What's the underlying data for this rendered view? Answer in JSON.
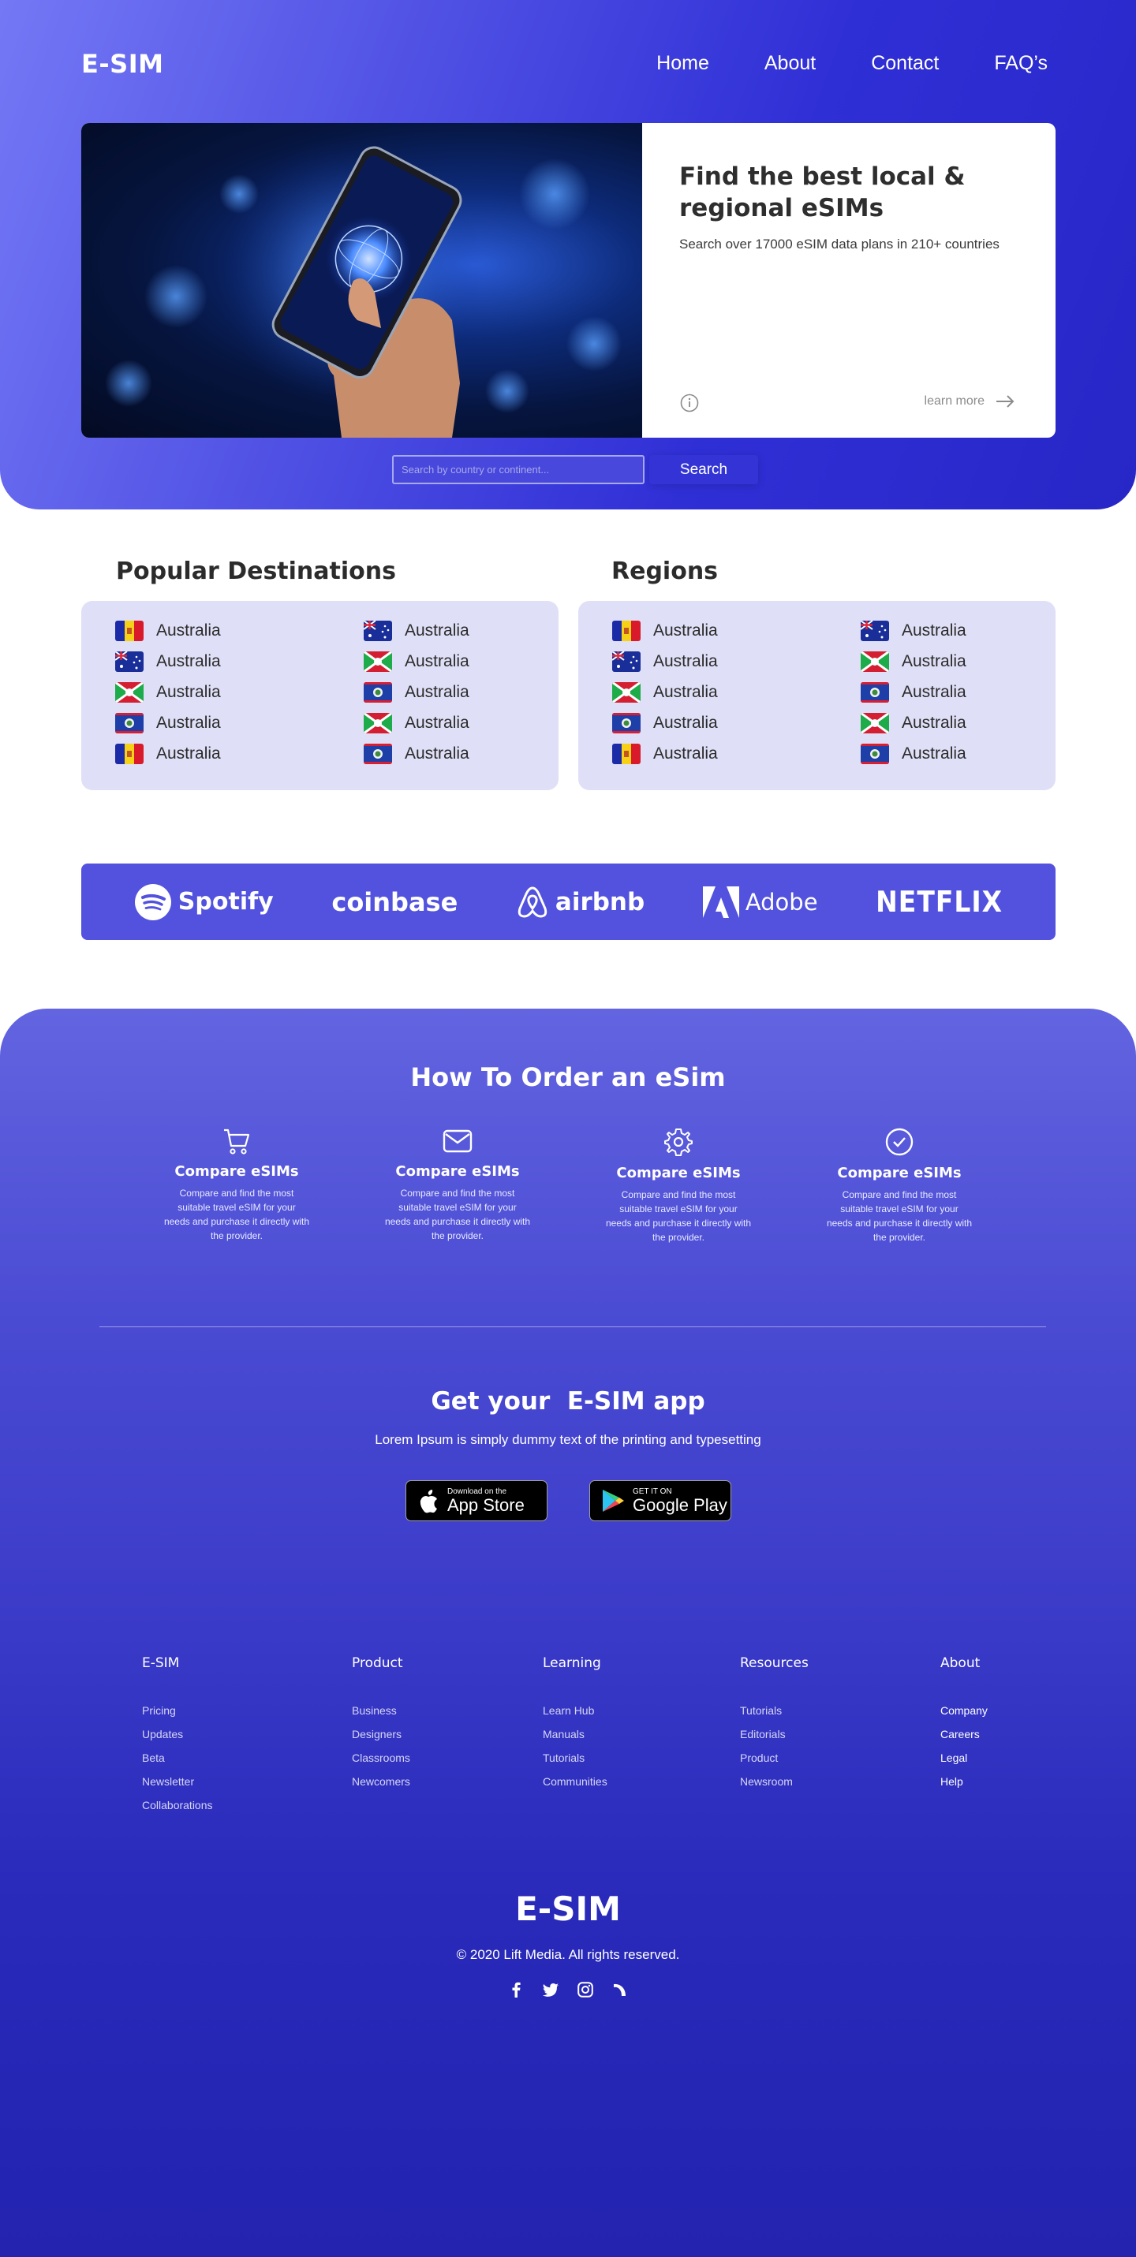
{
  "header": {
    "logo": "E-SIM",
    "nav": [
      "Home",
      "About",
      "Contact",
      "FAQ’s"
    ]
  },
  "hero": {
    "title_line1": "Find the best local &",
    "title_line2": "regional eSIMs",
    "subtitle": "Search over 17000 eSIM data plans in 210+ countries",
    "learn_more": "learn more"
  },
  "search": {
    "placeholder": "Search by country or continent...",
    "button": "Search"
  },
  "popular": {
    "title": "Popular Destinations",
    "items": [
      {
        "label": "Australia",
        "flag": "andorra"
      },
      {
        "label": "Australia",
        "flag": "australia"
      },
      {
        "label": "Australia",
        "flag": "australia"
      },
      {
        "label": "Australia",
        "flag": "burundi"
      },
      {
        "label": "Australia",
        "flag": "burundi"
      },
      {
        "label": "Australia",
        "flag": "belize"
      },
      {
        "label": "Australia",
        "flag": "belize"
      },
      {
        "label": "Australia",
        "flag": "burundi"
      },
      {
        "label": "Australia",
        "flag": "andorra"
      },
      {
        "label": "Australia",
        "flag": "belize"
      }
    ]
  },
  "regions": {
    "title": "Regions",
    "items": [
      {
        "label": "Australia",
        "flag": "andorra"
      },
      {
        "label": "Australia",
        "flag": "australia"
      },
      {
        "label": "Australia",
        "flag": "australia"
      },
      {
        "label": "Australia",
        "flag": "burundi"
      },
      {
        "label": "Australia",
        "flag": "burundi"
      },
      {
        "label": "Australia",
        "flag": "belize"
      },
      {
        "label": "Australia",
        "flag": "belize"
      },
      {
        "label": "Australia",
        "flag": "burundi"
      },
      {
        "label": "Australia",
        "flag": "andorra"
      },
      {
        "label": "Australia",
        "flag": "belize"
      }
    ]
  },
  "brands": [
    "Spotify",
    "coinbase",
    "airbnb",
    "Adobe",
    "NETFLIX"
  ],
  "how": {
    "title": "How To Order an eSim",
    "steps": [
      {
        "icon": "cart-icon",
        "title": "Compare eSIMs",
        "desc": "Compare and find the most suitable travel eSIM for your needs and purchase it directly with the provider."
      },
      {
        "icon": "mail-icon",
        "title": "Compare eSIMs",
        "desc": "Compare and find the most suitable travel eSIM for your needs and purchase it directly with the provider."
      },
      {
        "icon": "gear-icon",
        "title": "Compare eSIMs",
        "desc": "Compare and find the most suitable travel eSIM for your needs and purchase it directly with the provider."
      },
      {
        "icon": "check-circle-icon",
        "title": "Compare eSIMs",
        "desc": "Compare and find the most suitable travel eSIM for your needs and purchase it directly with the provider."
      }
    ]
  },
  "app": {
    "title": "Get your  E-SIM app",
    "subtitle": "Lorem Ipsum is simply dummy text of the printing and typesetting",
    "appstore_small": "Download on the",
    "appstore_big": "App Store",
    "googleplay_small": "GET IT ON",
    "googleplay_big": "Google Play"
  },
  "footer": {
    "columns": [
      {
        "heading": "E-SIM",
        "links": [
          "Pricing",
          "Updates",
          "Beta",
          "Newsletter",
          "Collaborations"
        ]
      },
      {
        "heading": "Product",
        "links": [
          "Business",
          "Designers",
          "Classrooms",
          "Newcomers"
        ]
      },
      {
        "heading": "Learning",
        "links": [
          "Learn Hub",
          "Manuals",
          "Tutorials",
          "Communities"
        ]
      },
      {
        "heading": "Resources",
        "links": [
          "Tutorials",
          "Editorials",
          "Product",
          "Newsroom"
        ]
      },
      {
        "heading": "About",
        "links": [
          "Company",
          "Careers",
          "Legal",
          "Help"
        ]
      }
    ],
    "logo": "E-SIM",
    "copyright": "© 2020 Lift Media. All rights reserved.",
    "socials": [
      "facebook-icon",
      "twitter-icon",
      "instagram-icon",
      "dribbble-icon"
    ]
  },
  "colors": {
    "hero_gradient_start": "#7478f5",
    "hero_gradient_end": "#2727c7",
    "card_bg": "#dfe0f7",
    "brands_bg": "#5252df",
    "footer_bg": "#2323b0"
  }
}
